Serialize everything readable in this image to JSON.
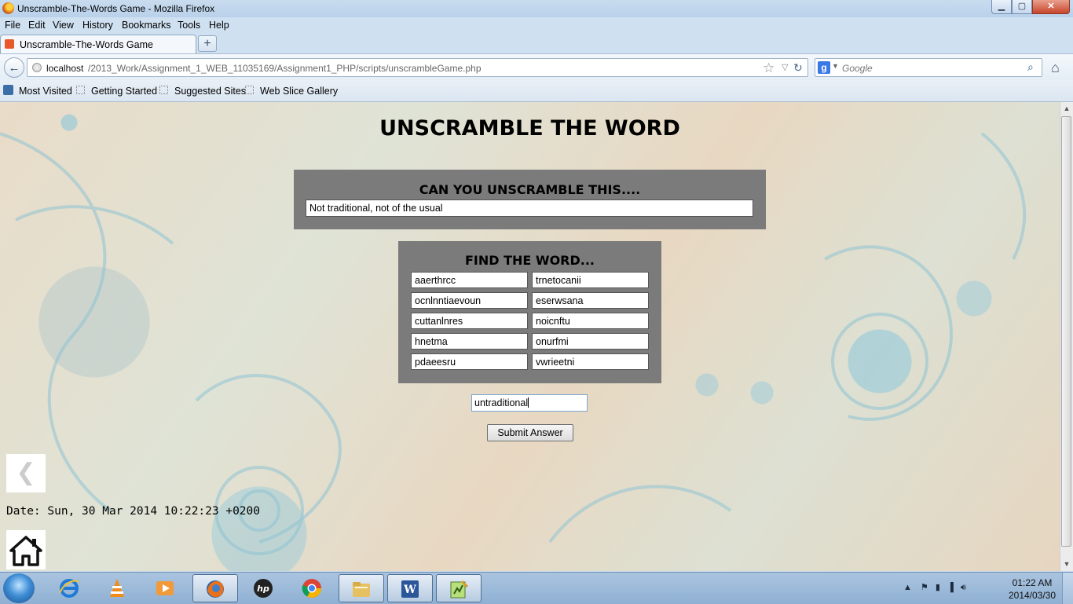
{
  "window": {
    "title": "Unscramble-The-Words Game - Mozilla Firefox",
    "minimize": "▁",
    "maximize": "▢",
    "close": "✕"
  },
  "menu": [
    "File",
    "Edit",
    "View",
    "History",
    "Bookmarks",
    "Tools",
    "Help"
  ],
  "tab": {
    "label": "Unscramble-The-Words Game",
    "new_tab": "+"
  },
  "address": {
    "host": "localhost",
    "path": "/2013_Work/Assignment_1_WEB_11035169/Assignment1_PHP/scripts/unscrambleGame.php"
  },
  "search": {
    "placeholder": "Google"
  },
  "bookmarks": [
    "Most Visited",
    "Getting Started",
    "Suggested Sites",
    "Web Slice Gallery"
  ],
  "page": {
    "heading": "UNSCRAMBLE THE WORD",
    "clue_heading": "CAN YOU UNSCRAMBLE THIS....",
    "clue": "Not traditional, not of the usual",
    "words_heading": "FIND THE WORD...",
    "words": [
      [
        "aaerthrcc",
        "trnetocanii"
      ],
      [
        "ocnlnntiaevoun",
        "eserwsana"
      ],
      [
        "cuttanlnres",
        "noicnftu"
      ],
      [
        "hnetma",
        "onurfmi"
      ],
      [
        "pdaeesru",
        "vwrieetni"
      ]
    ],
    "answer": "untraditional",
    "submit": "Submit Answer",
    "back_glyph": "❮",
    "date": "Date: Sun, 30 Mar 2014 10:22:23 +0200"
  },
  "taskbar": {
    "apps": [
      "internet-explorer",
      "vlc",
      "media-player",
      "firefox",
      "hp",
      "chrome",
      "file-explorer",
      "word",
      "notepad-plus"
    ],
    "active_app": "firefox",
    "clock_time": "01:22 AM",
    "clock_date": "2014/03/30"
  },
  "colors": {
    "panel": "#7b7b7b",
    "accent": "#3f8ed6"
  }
}
